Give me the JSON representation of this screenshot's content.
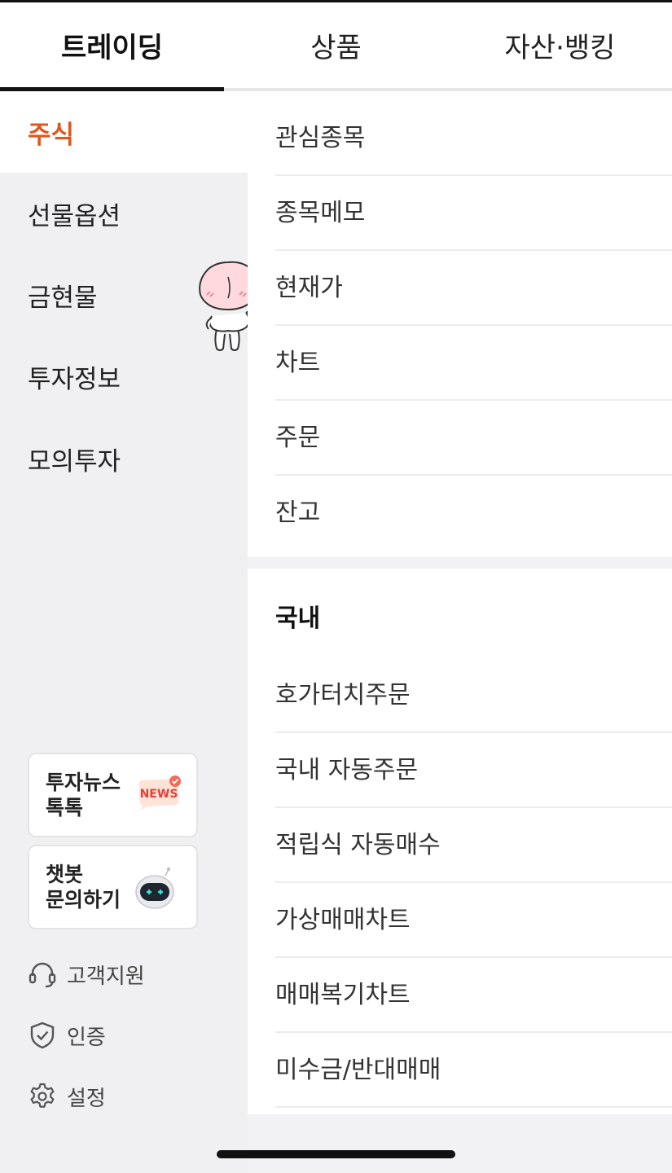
{
  "tabs": [
    {
      "label": "트레이딩",
      "active": true
    },
    {
      "label": "상품",
      "active": false
    },
    {
      "label": "자산·뱅킹",
      "active": false
    }
  ],
  "sidebar": {
    "items": [
      {
        "label": "주식",
        "active": true
      },
      {
        "label": "선물옵션",
        "active": false
      },
      {
        "label": "금현물",
        "active": false
      },
      {
        "label": "투자정보",
        "active": false
      },
      {
        "label": "모의투자",
        "active": false
      }
    ],
    "cards": [
      {
        "label": "투자뉴스\n톡톡",
        "icon": "news-icon",
        "badge_text": "NEWS"
      },
      {
        "label": "챗봇\n문의하기",
        "icon": "chatbot-robot-icon"
      }
    ],
    "links": [
      {
        "label": "고객지원",
        "icon": "headset-icon"
      },
      {
        "label": "인증",
        "icon": "shield-check-icon"
      },
      {
        "label": "설정",
        "icon": "gear-icon"
      }
    ]
  },
  "menu": {
    "general": [
      "관심종목",
      "종목메모",
      "현재가",
      "차트",
      "주문",
      "잔고"
    ],
    "domestic": {
      "title": "국내",
      "items": [
        "호가터치주문",
        "국내 자동주문",
        "적립식 자동매수",
        "가상매매차트",
        "매매복기차트",
        "미수금/반대매매"
      ]
    }
  },
  "colors": {
    "accent": "#e0561c",
    "sidebar_bg": "#f0f0f2",
    "active_underline": "#111111"
  }
}
